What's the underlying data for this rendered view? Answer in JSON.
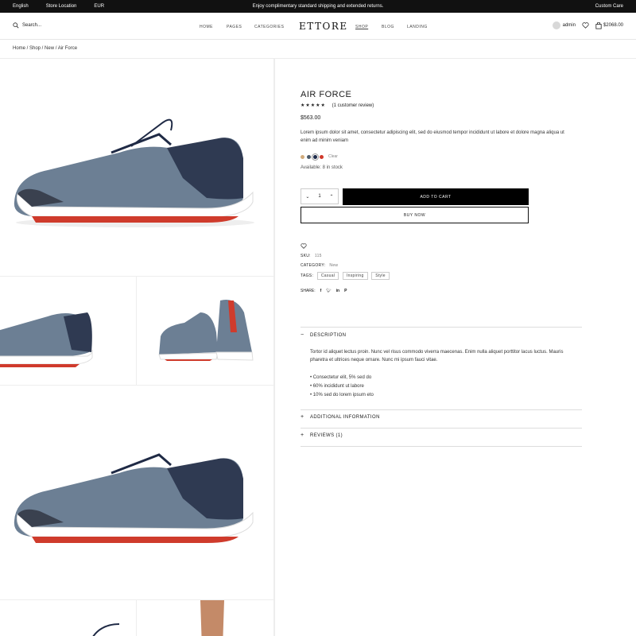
{
  "topbar": {
    "language": "English",
    "store_location": "Store Location",
    "currency": "EUR",
    "promo": "Enjoy complimentary standard shipping and extended returns.",
    "customer_care": "Custom Care"
  },
  "header": {
    "search_label": "Search...",
    "nav": [
      "HOME",
      "PAGES",
      "CATEGORIES",
      "SHOP",
      "BLOG",
      "LANDING"
    ],
    "logo": "ETTORE",
    "user": "admin",
    "cart_total": "$2068.00"
  },
  "breadcrumb": "Home / Shop / New / Air Force",
  "product": {
    "title": "AIR FORCE",
    "stars": "★★★★★",
    "review_count": "(1 customer review)",
    "price": "$563.00",
    "description": "Lorem ipsum dolor sit amet, consectetur adipiscing elit, sed do eiusmod tempor incididunt ut labore et dolore magna aliqua ut enim ad minim veniam",
    "swatch_colors": [
      "#d1ab7c",
      "#4b5a6a",
      "#1c2a4a",
      "#d0392b"
    ],
    "clear_label": "Clear",
    "stock": "Available: 8 in stock",
    "quantity": "1",
    "add_to_cart": "ADD TO CART",
    "buy_now": "BUY NOW",
    "sku_label": "SKU:",
    "sku": "115",
    "category_label": "CATEGORY:",
    "category": "New",
    "tags_label": "TAGS:",
    "tags": [
      "Casual",
      "Inspiring",
      "Style"
    ],
    "share_label": "SHARE:"
  },
  "accordion": {
    "description_title": "DESCRIPTION",
    "description_text": "Tortor id aliquet lectus proin. Nunc vel risus commodo viverra maecenas. Enim nulla aliquet porttitor lacus luctus. Mauris pharetra et ultrices neque ornare. Nunc mi ipsum fauci vitae.",
    "bullets": [
      "Consectetur elit, 5% sed do",
      "60% incididunt ut labore",
      "10% sed do lorem ipsum eto"
    ],
    "additional_title": "ADDITIONAL INFORMATION",
    "reviews_title": "REVIEWS (1)"
  },
  "icons": {
    "search": "search-icon",
    "user": "user-icon",
    "heart": "heart-icon",
    "cart": "cart-icon",
    "share": [
      "facebook-icon",
      "twitter-icon",
      "linkedin-icon",
      "pinterest-icon"
    ]
  }
}
